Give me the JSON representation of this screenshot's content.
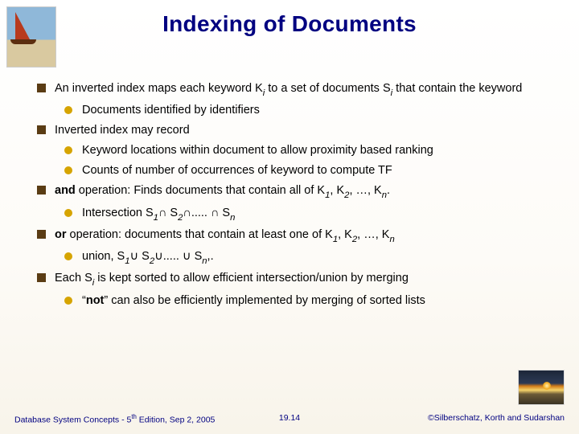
{
  "title": "Indexing of Documents",
  "bullets": {
    "b1": {
      "pre": "An inverted index maps each keyword ",
      "k": "K",
      "ki": "i",
      "mid": " to a set of documents ",
      "s": "S",
      "si": "i",
      "post": " that contain the keyword"
    },
    "b1_1": "Documents identified by identifiers",
    "b2": "Inverted index may record",
    "b2_1": "Keyword locations within document to allow proximity based ranking",
    "b2_2": "Counts of number of occurrences of keyword to compute TF",
    "b3": {
      "op": "and",
      "rest": " operation: Finds documents that contain all of  K",
      "s1": "1",
      "c1": ", K",
      "s2": "2",
      "c2": ", …, K",
      "sn": "n",
      "dot": "."
    },
    "b3_1": {
      "pre": "Intersection S",
      "s1": "1",
      "cap1": "∩ S",
      "s2": "2",
      "mid": "∩..... ∩ S",
      "sn": "n"
    },
    "b4": {
      "op": "or",
      "rest": " operation: documents that contain at least one of  K",
      "s1": "1",
      "c1": ", K",
      "s2": "2",
      "c2": ", …, K",
      "sn": "n"
    },
    "b4_1": {
      "pre": "union, S",
      "s1": "1",
      "cap1": "∪ S",
      "s2": "2",
      "mid": "∪..... ∪ S",
      "sn": "n",
      "tail": ",."
    },
    "b5": {
      "pre": "Each S",
      "si": "i",
      "post": " is kept sorted to allow efficient intersection/union by merging"
    },
    "b5_1": {
      "q1": "“",
      "op": "not",
      "q2": "”",
      "rest": " can also be efficiently implemented by merging of sorted lists"
    }
  },
  "footer": {
    "left_pre": "Database System Concepts - 5",
    "left_sup": "th",
    "left_post": " Edition, Sep 2, 2005",
    "center": "19.14",
    "right": "©Silberschatz, Korth and Sudarshan"
  }
}
